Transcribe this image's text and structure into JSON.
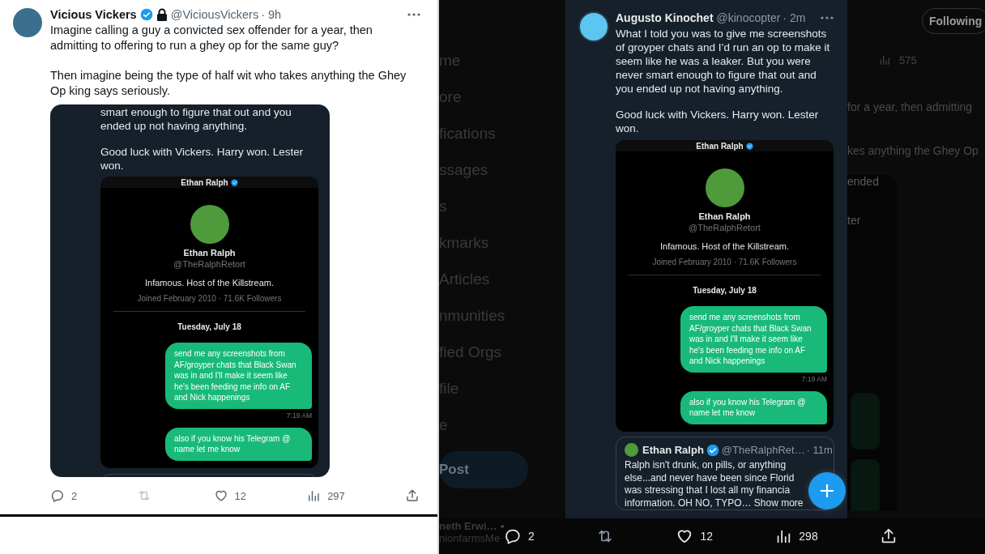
{
  "left_post": {
    "author": {
      "name": "Vicious Vickers",
      "verified": true,
      "protected": true,
      "handle": "@ViciousVickers",
      "time": "· 9h"
    },
    "paragraphs": [
      "Imagine calling a guy a convicted sex offender for a year, then admitting to offering to run a ghey op for the same guy?",
      "Then imagine being the type of half wit who takes anything the Ghey Op king says seriously."
    ],
    "media": {
      "paragraphs": [
        "smart enough to figure that out and you ended up not having anything.",
        "Good luck with Vickers. Harry won. Lester won."
      ],
      "dm": {
        "header": "Ethan Ralph",
        "verified": true,
        "name": "Ethan Ralph",
        "handle": "@TheRalphRetort",
        "bio": "Infamous. Host of the Killstream.",
        "joined": "Joined February 2010 · 71.6K Followers",
        "date": "Tuesday, July 18",
        "messages": [
          {
            "text": "send me any screenshots from AF/groyper chats that Black Swan was in and I'll make it seem like he's been feeding me info on AF and Nick happenings",
            "time": "7:19 AM"
          },
          {
            "text": "also if you know his Telegram @ name let me know"
          }
        ]
      }
    },
    "actions": {
      "replies": "2",
      "retweet_disabled": true,
      "likes": "12",
      "views": "297"
    }
  },
  "background": {
    "sidebar_items": [
      "me",
      "ore",
      "fications",
      "ssages",
      "s",
      "kmarks",
      "Articles",
      "nmunities",
      "fied Orgs",
      "file",
      "e"
    ],
    "post_button": "Post",
    "account": {
      "name": "neth Erwi…",
      "verified": true,
      "handle": "nionfarmsMe"
    },
    "follow_button": "Following",
    "views": "575",
    "feed_fragments": [
      "for a year, then admitting",
      "kes anything the Ghey Op"
    ],
    "card_fragments": [
      "ended",
      "ter"
    ]
  },
  "modal_post": {
    "author": {
      "name": "Augusto Kinochet",
      "handle": "@kinocopter",
      "time": "· 2m"
    },
    "paragraphs": [
      "What I told you was to give me screenshots of groyper chats and I’d run an op to make it seem like he was a leaker. But you were never smart enough to figure that out and you ended up not having anything.",
      "Good luck with Vickers. Harry won. Lester won."
    ],
    "dm": {
      "header": "Ethan Ralph",
      "verified": true,
      "name": "Ethan Ralph",
      "handle": "@TheRalphRetort",
      "bio": "Infamous. Host of the Killstream.",
      "joined": "Joined February 2010 · 71.6K Followers",
      "date": "Tuesday, July 18",
      "messages": [
        {
          "text": "send me any screenshots from AF/groyper chats that Black Swan was in and I'll make it seem like he's been feeding me info on AF and Nick happenings",
          "time": "7:19 AM"
        },
        {
          "text": "also if you know his Telegram @ name let me know"
        }
      ]
    },
    "quoted_post": {
      "author": {
        "name": "Ethan Ralph",
        "verified": true,
        "handle": "@TheRalphRet…",
        "time": "· 11m"
      },
      "text": "Ralph isn't drunk, on pills, or anything\nelse...and never have been since Florid\nwas stressing that I lost all my financia\ninformation. OH NO, TYPO…",
      "show_more": "Show more"
    },
    "actions": {
      "replies": "2",
      "retweet_disabled": true,
      "likes": "12",
      "views": "298"
    }
  }
}
